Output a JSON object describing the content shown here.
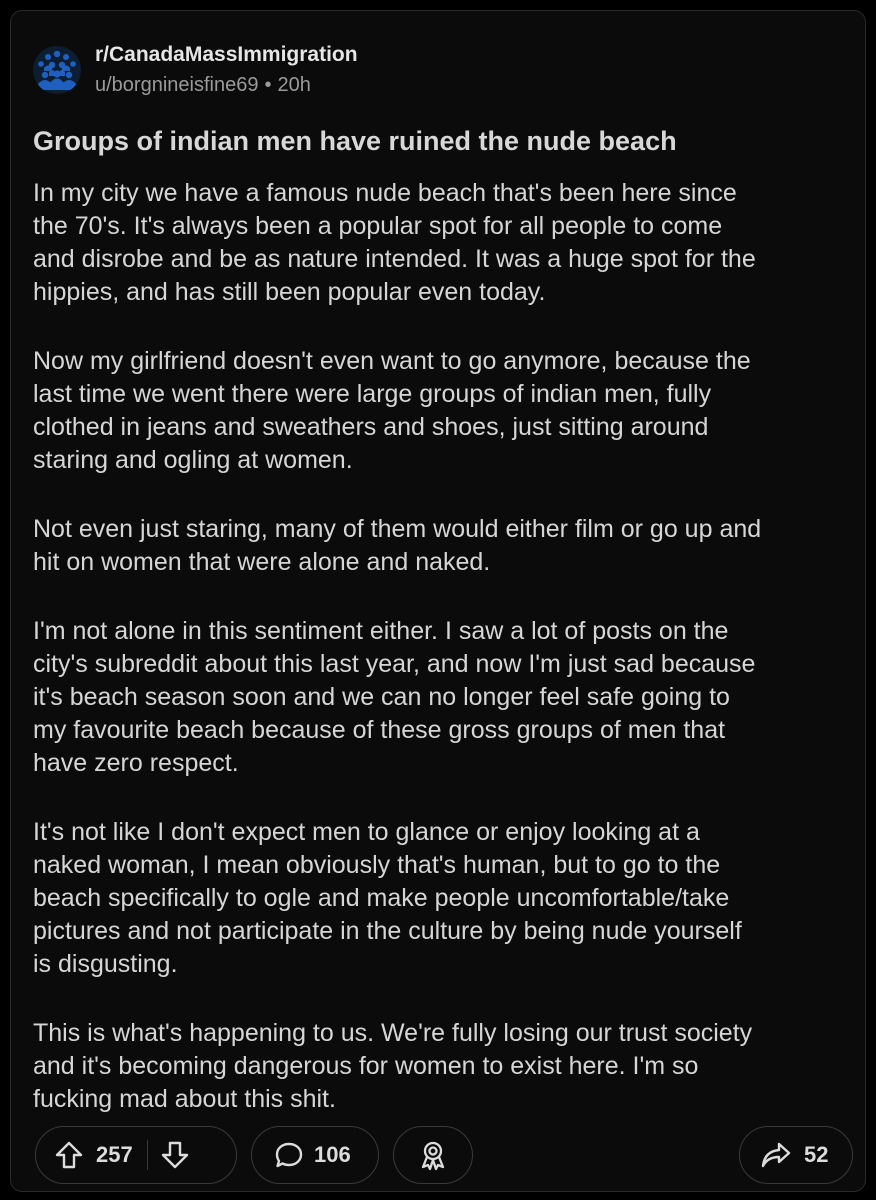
{
  "post": {
    "subreddit": "r/CanadaMassImmigration",
    "author": "u/borgnineisfine69",
    "separator": "•",
    "age": "20h",
    "title": "Groups of indian men have ruined the nude beach",
    "paragraphs": [
      "In my city we have a famous nude beach that's been here since\nthe 70's. It's always been a popular spot for all people to come\nand disrobe and be as nature intended. It was a huge spot for the\nhippies, and has still been popular even today.",
      "Now my girlfriend doesn't even want to go anymore, because the\nlast time we went there were large groups of indian men, fully\nclothed in jeans and sweathers and shoes, just sitting around\nstaring and ogling at women.",
      "Not even just staring, many of them would either film or go up and\nhit on women that were alone and naked.",
      "I'm not alone in this sentiment either. I saw a lot of posts on the\ncity's subreddit about this last year, and now I'm just sad because\nit's beach season soon and we can no longer feel safe going to\nmy favourite beach because of these gross groups of men that\nhave zero respect.",
      "It's not like I don't expect men to glance or enjoy looking at a\nnaked woman, I mean obviously that's human, but to go to the\nbeach specifically to ogle and make people uncomfortable/take\npictures and not participate in the culture by being nude yourself\nis disgusting.",
      "This is what's happening to us. We're fully losing our trust society\nand it's becoming dangerous for women to exist here. I'm so\nfucking mad about this shit."
    ]
  },
  "actions": {
    "votes": "257",
    "comments": "106",
    "shares": "52"
  },
  "icons": {
    "avatar": "community-avatar-icon",
    "upvote": "upvote-arrow-icon",
    "downvote": "downvote-arrow-icon",
    "comment": "comment-bubble-icon",
    "award": "award-ribbon-icon",
    "share": "share-arrow-icon"
  },
  "colors": {
    "background": "#0b0b0b",
    "text": "#d6d6d6",
    "muted": "#9a9a9a",
    "border": "#3a3a3a",
    "avatar_bg": "#0d1e33",
    "avatar_fg": "#1f5fbf"
  }
}
